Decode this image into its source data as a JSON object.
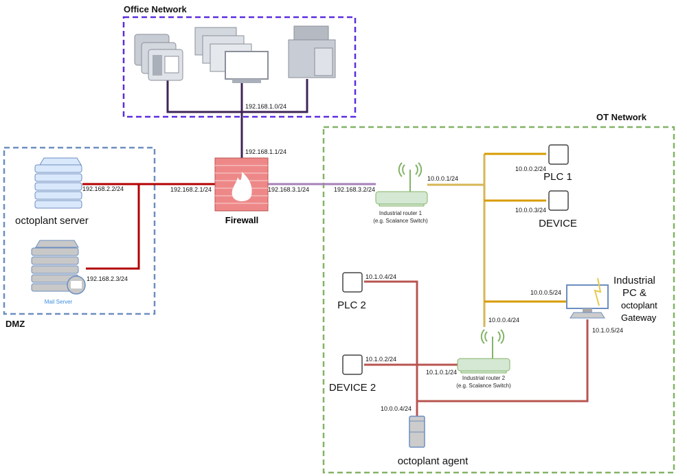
{
  "zones": {
    "office": {
      "title": "Office Network",
      "color": "#5b2be0"
    },
    "dmz": {
      "title": "DMZ",
      "color": "#6c8ebf"
    },
    "ot": {
      "title": "OT Network",
      "color": "#82b366"
    }
  },
  "nodes": {
    "firewall": "Firewall",
    "octoplant_server": "octoplant server",
    "mail_server": "Mail Server",
    "router1": {
      "line1": "Industrial router 1",
      "line2": "(e.g. Scalance Switch)"
    },
    "router2": {
      "line1": "Industrial router 2",
      "line2": "(e.g. Scalance Switch)"
    },
    "plc1": "PLC 1",
    "device": "DEVICE",
    "plc2": "PLC 2",
    "device2": "DEVICE 2",
    "industrial_pc": [
      "Industrial",
      "PC &",
      "octoplant",
      "Gateway"
    ],
    "agent": "octoplant agent"
  },
  "addresses": {
    "office_net": "192.168.1.0/24",
    "fw_office": "192.168.1.1/24",
    "server": "192.168.2.2/24",
    "fw_dmz": "192.168.2.1/24",
    "mail": "192.168.2.3/24",
    "fw_ot": "192.168.3.1/24",
    "r1_wan": "192.168.3.2/24",
    "r1_lan": "10.0.0.1/24",
    "plc1": "10.0.0.2/24",
    "device": "10.0.0.3/24",
    "ipc_ot": "10.0.0.5/24",
    "r2_wan": "10.0.0.4/24",
    "plc2": "10.1.0.4/24",
    "device2": "10.1.0.2/24",
    "r2_lan": "10.1.0.1/24",
    "ipc_lan": "10.1.0.5/24",
    "agent": "10.0.0.4/24"
  },
  "colors": {
    "office_link": "#3d2454",
    "dmz_link": "#b20000",
    "fw_ot_link": "#a680b8",
    "ot_trunk": "#d6b656",
    "ot_branch": "#d79b00",
    "lan2_link": "#b85450",
    "firewall": "#e07a7a",
    "router": "#82b366"
  }
}
